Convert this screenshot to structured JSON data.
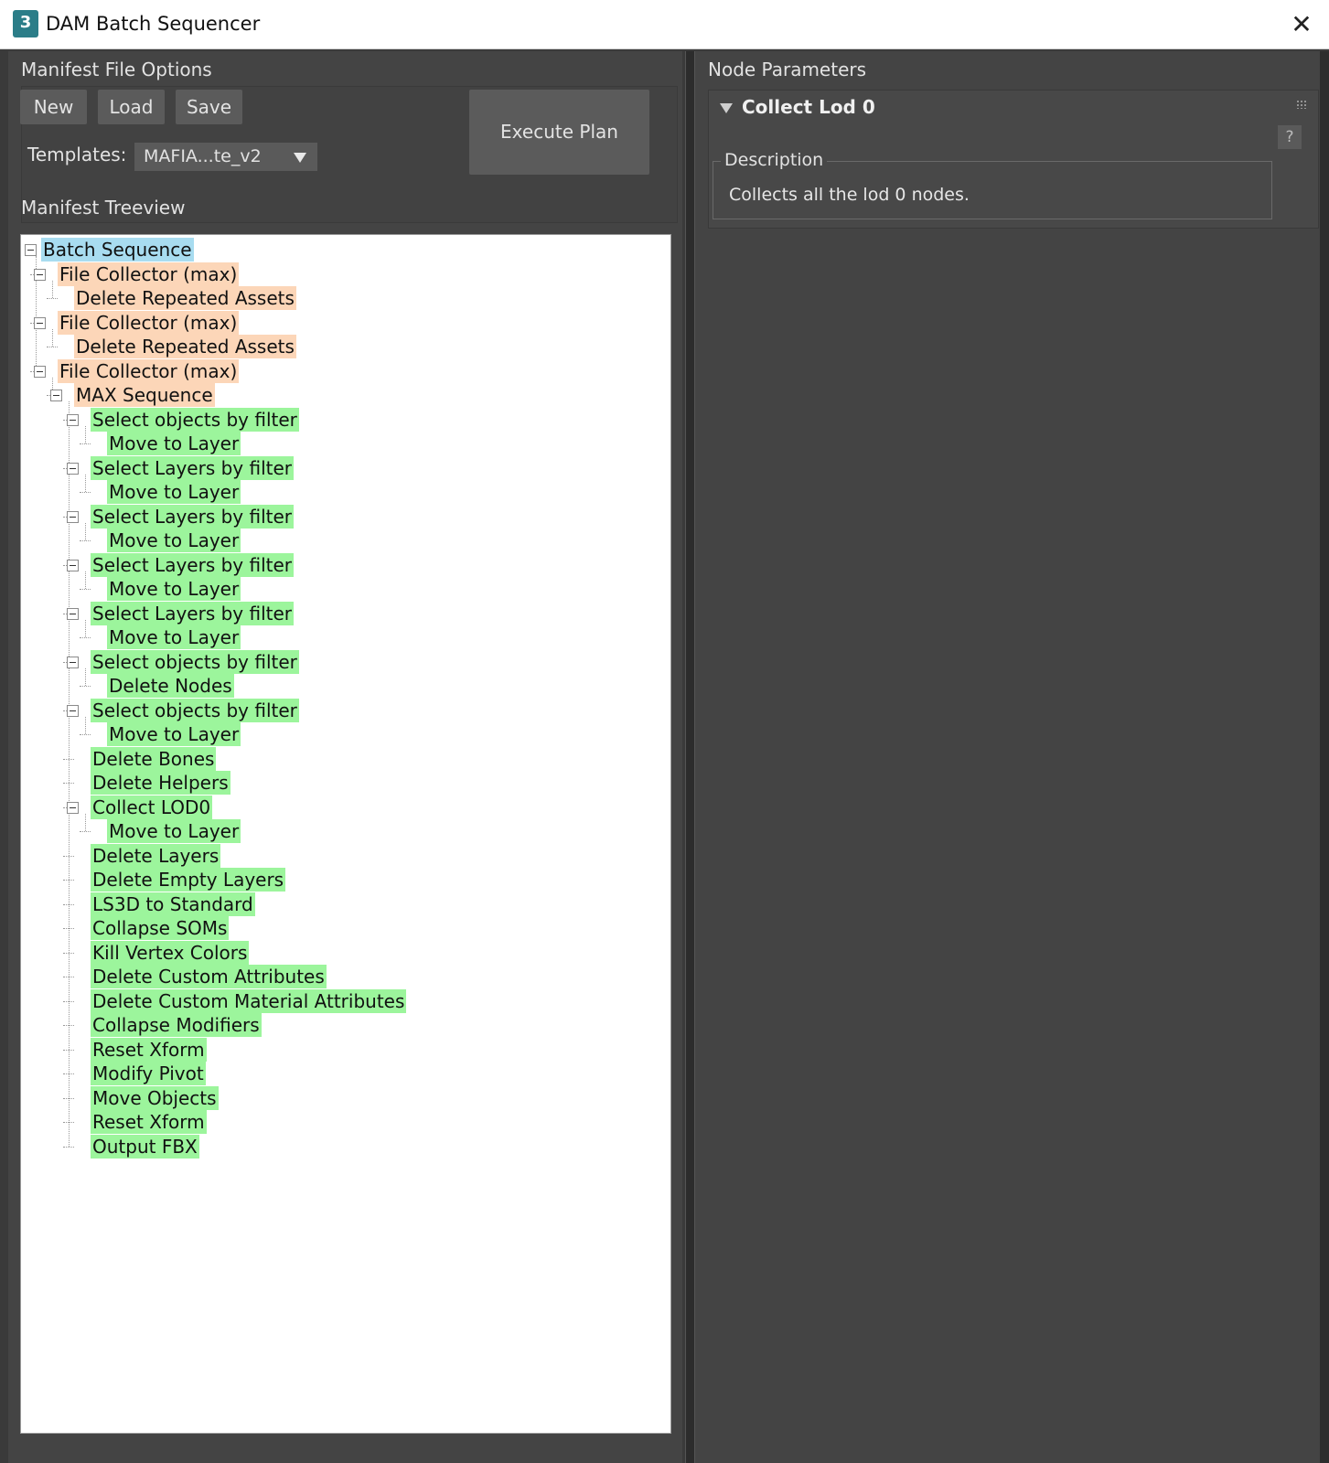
{
  "window": {
    "title": "DAM Batch Sequencer",
    "icon": "3ds-max-icon",
    "icon_text": "3",
    "close": "✕"
  },
  "left": {
    "manifest_group": "Manifest File Options",
    "buttons": {
      "new": "New",
      "load": "Load",
      "save": "Save",
      "execute": "Execute Plan"
    },
    "templates_label": "Templates:",
    "templates_value": "MAFIA...te_v2",
    "tree_group": "Manifest Treeview"
  },
  "tree": [
    {
      "label": "Batch Sequence",
      "depth": 0,
      "color": "blue",
      "toggle": true
    },
    {
      "label": "File Collector (max)",
      "depth": 1,
      "color": "orange",
      "toggle": true
    },
    {
      "label": "Delete Repeated Assets",
      "depth": 2,
      "color": "orange",
      "toggle": false
    },
    {
      "label": "File Collector (max)",
      "depth": 1,
      "color": "orange",
      "toggle": true
    },
    {
      "label": "Delete Repeated Assets",
      "depth": 2,
      "color": "orange",
      "toggle": false
    },
    {
      "label": "File Collector (max)",
      "depth": 1,
      "color": "orange",
      "toggle": true
    },
    {
      "label": "MAX Sequence",
      "depth": 2,
      "color": "orange",
      "toggle": true
    },
    {
      "label": "Select objects by filter",
      "depth": 3,
      "color": "green",
      "toggle": true
    },
    {
      "label": "Move to Layer",
      "depth": 4,
      "color": "green",
      "toggle": false
    },
    {
      "label": "Select Layers by filter",
      "depth": 3,
      "color": "green",
      "toggle": true
    },
    {
      "label": "Move to Layer",
      "depth": 4,
      "color": "green",
      "toggle": false
    },
    {
      "label": "Select Layers by filter",
      "depth": 3,
      "color": "green",
      "toggle": true
    },
    {
      "label": "Move to Layer",
      "depth": 4,
      "color": "green",
      "toggle": false
    },
    {
      "label": "Select Layers by filter",
      "depth": 3,
      "color": "green",
      "toggle": true
    },
    {
      "label": "Move to Layer",
      "depth": 4,
      "color": "green",
      "toggle": false
    },
    {
      "label": "Select Layers by filter",
      "depth": 3,
      "color": "green",
      "toggle": true
    },
    {
      "label": "Move to Layer",
      "depth": 4,
      "color": "green",
      "toggle": false
    },
    {
      "label": "Select objects by filter",
      "depth": 3,
      "color": "green",
      "toggle": true
    },
    {
      "label": "Delete Nodes",
      "depth": 4,
      "color": "green",
      "toggle": false
    },
    {
      "label": "Select objects by filter",
      "depth": 3,
      "color": "green",
      "toggle": true
    },
    {
      "label": "Move to Layer",
      "depth": 4,
      "color": "green",
      "toggle": false
    },
    {
      "label": "Delete Bones",
      "depth": 3,
      "color": "green",
      "toggle": false
    },
    {
      "label": "Delete Helpers",
      "depth": 3,
      "color": "green",
      "toggle": false
    },
    {
      "label": "Collect LOD0",
      "depth": 3,
      "color": "green",
      "toggle": true
    },
    {
      "label": "Move to Layer",
      "depth": 4,
      "color": "green",
      "toggle": false
    },
    {
      "label": "Delete Layers",
      "depth": 3,
      "color": "green",
      "toggle": false
    },
    {
      "label": "Delete Empty Layers",
      "depth": 3,
      "color": "green",
      "toggle": false
    },
    {
      "label": "LS3D to Standard",
      "depth": 3,
      "color": "green",
      "toggle": false
    },
    {
      "label": "Collapse SOMs",
      "depth": 3,
      "color": "green",
      "toggle": false
    },
    {
      "label": "Kill Vertex Colors",
      "depth": 3,
      "color": "green",
      "toggle": false
    },
    {
      "label": "Delete Custom Attributes",
      "depth": 3,
      "color": "green",
      "toggle": false
    },
    {
      "label": "Delete Custom Material Attributes",
      "depth": 3,
      "color": "green",
      "toggle": false
    },
    {
      "label": "Collapse Modifiers",
      "depth": 3,
      "color": "green",
      "toggle": false
    },
    {
      "label": "Reset Xform",
      "depth": 3,
      "color": "green",
      "toggle": false
    },
    {
      "label": "Modify Pivot",
      "depth": 3,
      "color": "green",
      "toggle": false
    },
    {
      "label": "Move Objects",
      "depth": 3,
      "color": "green",
      "toggle": false
    },
    {
      "label": "Reset Xform",
      "depth": 3,
      "color": "green",
      "toggle": false
    },
    {
      "label": "Output FBX",
      "depth": 3,
      "color": "green",
      "toggle": false
    }
  ],
  "right": {
    "group": "Node Parameters",
    "rollout_title": "Collect Lod 0",
    "help": "?",
    "description_label": "Description",
    "description_text": "Collects all the lod 0 nodes."
  }
}
